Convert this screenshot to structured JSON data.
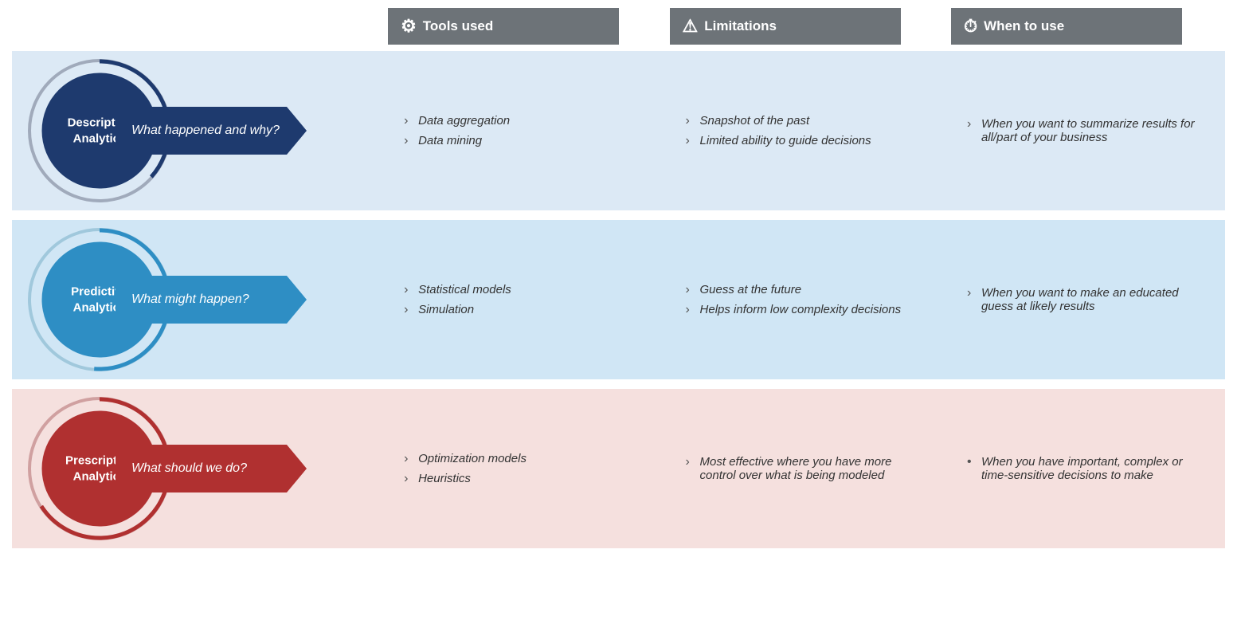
{
  "header": {
    "tools_label": "Tools used",
    "limitations_label": "Limitations",
    "when_label": "When to use",
    "tools_icon": "⚙",
    "limitations_icon": "⚠",
    "when_icon": "⏱"
  },
  "rows": [
    {
      "id": "descriptive",
      "title_line1": "Descriptive",
      "title_line2": "Analytics",
      "question": "What happened and why?",
      "circle_color": "#1e3a6e",
      "arrow_color": "#1e3a6e",
      "arc_color": "#1e3a6e",
      "bg": "bg-blue-light",
      "tools": [
        "Data aggregation",
        "Data mining"
      ],
      "limitations": [
        "Snapshot of the past",
        "Limited ability to guide decisions"
      ],
      "when_to_use_parts": [
        "When you want to summarize results for all/part of your business"
      ],
      "bullet_type": "chevron"
    },
    {
      "id": "predictive",
      "title_line1": "Predictive",
      "title_line2": "Analytics",
      "question": "What might happen?",
      "circle_color": "#2e8ec4",
      "arrow_color": "#2e8ec4",
      "arc_color": "#2e8ec4",
      "bg": "bg-blue-medium",
      "tools": [
        "Statistical models",
        "Simulation"
      ],
      "limitations": [
        "Guess at the future",
        "Helps inform low complexity decisions"
      ],
      "when_to_use_parts": [
        "When you want to make an educated guess at likely results"
      ],
      "bullet_type": "chevron"
    },
    {
      "id": "prescriptive",
      "title_line1": "Prescriptive",
      "title_line2": "Analytics",
      "question": "What should we do?",
      "circle_color": "#b03030",
      "arrow_color": "#b03030",
      "arc_color": "#b03030",
      "bg": "bg-red-light",
      "tools": [
        "Optimization models",
        "Heuristics"
      ],
      "limitations": [
        "Most effective where you have more control over what is being modeled"
      ],
      "when_to_use_parts": [
        "When you have important, complex or time-sensitive decisions to make"
      ],
      "bullet_type": "bullet"
    }
  ]
}
